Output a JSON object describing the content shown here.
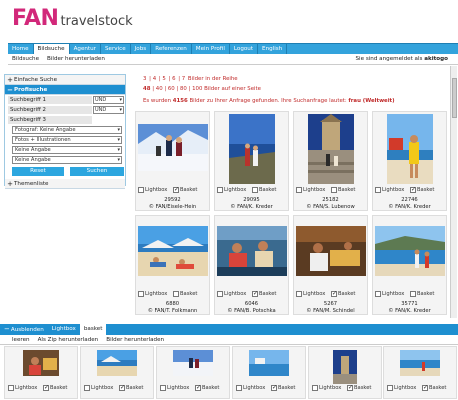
{
  "brand": {
    "part1": "FAN",
    "part2": "travelstock",
    "accent": "#d2287a",
    "nav_color": "#33a3dc"
  },
  "nav": {
    "items": [
      "Home",
      "Bildsuche",
      "Agentur",
      "Service",
      "Jobs",
      "Referenzen",
      "Mein Profil",
      "Logout",
      "English"
    ],
    "active_index": 1
  },
  "subnav": {
    "items": [
      "Bildsuche",
      "Bilder herunterladen"
    ],
    "login_prefix": "Sie sind angemeldet als",
    "login_user": "akitogo"
  },
  "search": {
    "simple_label": "Einfache Suche",
    "pro_label": "Profisuche",
    "terms": [
      {
        "label": "Suchbegriff 1",
        "op": "UND"
      },
      {
        "label": "Suchbegriff 2",
        "op": "UND"
      },
      {
        "label": "Suchbegriff 3"
      }
    ],
    "filters": [
      "Fotograf: Keine Angabe",
      "Fotos + Illustrationen",
      "Keine Angabe",
      "Keine Angabe"
    ],
    "reset_label": "Reset",
    "search_label": "Suchen",
    "themes_label": "Themenliste"
  },
  "results": {
    "pages": [
      "3",
      "4",
      "5",
      "6",
      "7"
    ],
    "pages_suffix": "Bilder in der Reihe",
    "perpage_options": [
      "48",
      "40",
      "60",
      "80",
      "100"
    ],
    "perpage_suffix": "Bilder auf einer Seite",
    "count_prefix": "Es wurden",
    "count": "4156",
    "count_mid": "Bilder zu Ihrer Anfrage gefunden. Ihre Suchanfrage lautet:",
    "query": "frau (Weltweit)"
  },
  "labels": {
    "lightbox": "Lightbox",
    "basket": "Basket"
  },
  "cards": [
    {
      "id": "29592",
      "credit": "© FAN/Eisele-Hein",
      "basket": true,
      "img": "ski"
    },
    {
      "id": "29095",
      "credit": "© FAN/K. Kreder",
      "basket": false,
      "img": "coast"
    },
    {
      "id": "25182",
      "credit": "© FAN/S. Lubenow",
      "basket": false,
      "img": "temple"
    },
    {
      "id": "22746",
      "credit": "© FAN/K. Kreder",
      "basket": true,
      "img": "beach_yellow"
    },
    {
      "id": "6880",
      "credit": "© FAN/T. Folkmann",
      "basket": false,
      "img": "beach_crowd"
    },
    {
      "id": "6046",
      "credit": "© FAN/B. Potschka",
      "basket": true,
      "img": "people_sea"
    },
    {
      "id": "5267",
      "credit": "© FAN/M. Schindel",
      "basket": true,
      "img": "market"
    },
    {
      "id": "35771",
      "credit": "© FAN/K. Kreder",
      "basket": false,
      "img": "shore"
    }
  ],
  "bottom": {
    "tabs": [
      "Ausblenden",
      "Lightbox",
      "basket"
    ],
    "active_index": 2,
    "actions": [
      "leeren",
      "Als Zip herunterladen",
      "Bilder herunterladen"
    ]
  },
  "basket_items": [
    {
      "img": "b1"
    },
    {
      "img": "b2"
    },
    {
      "img": "b3"
    },
    {
      "img": "b4"
    },
    {
      "img": "b5"
    },
    {
      "img": "b6"
    }
  ]
}
